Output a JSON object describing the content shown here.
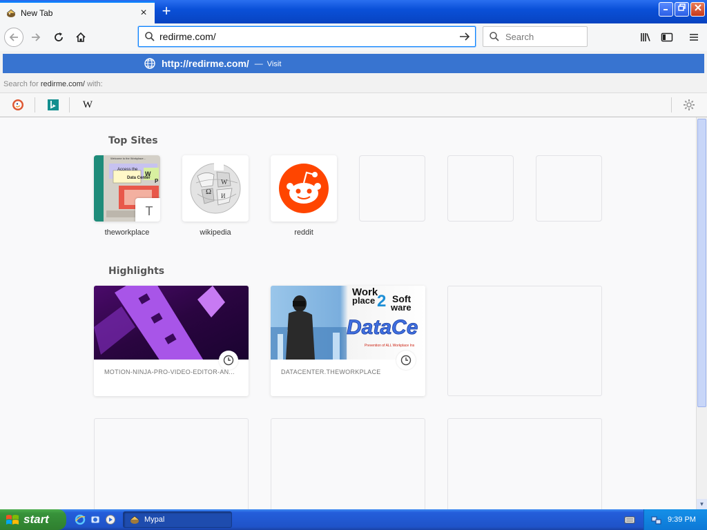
{
  "browser": {
    "tab_title": "New Tab",
    "tab_close": "×",
    "new_tab": "+",
    "url": "redirme.com/",
    "search_placeholder": "Search"
  },
  "popup": {
    "visit_url": "http://redirme.com/",
    "visit_dash": "—",
    "visit_label": "Visit",
    "search_for_prefix": "Search for",
    "search_for_query": "redirme.com/",
    "search_for_suffix": "with:",
    "engines": [
      "duckduckgo-icon",
      "bing-icon",
      "wikipedia-icon"
    ],
    "wiki_glyph": "W"
  },
  "content": {
    "top_sites_title": "Top Sites",
    "highlights_title": "Highlights",
    "top_sites": [
      {
        "label": "theworkplace",
        "badge": "T"
      },
      {
        "label": "wikipedia"
      },
      {
        "label": "reddit"
      }
    ],
    "highlights": [
      {
        "text": "MOTION-NINJA-PRO-VIDEO-EDITOR-AN..."
      },
      {
        "text": "DATACENTER.THEWORKPLACE",
        "brand1": "Work",
        "brand2": "place",
        "brand3": "2",
        "brand4": "Soft",
        "brand5": "ware",
        "brand6": "DataCe",
        "tagline": "Prevention of ALL Workplace Ins"
      }
    ],
    "tile_texts": [
      "Welcome to the Workplace...",
      "Access the",
      "Data Center",
      "W",
      "P"
    ]
  },
  "taskbar": {
    "start_label": "start",
    "window_label": "Mypal",
    "clock": "9:39 PM"
  },
  "colors": {
    "accent": "#0a84ff",
    "visit_row": "#3874d0",
    "reddit": "#ff4500",
    "taskbar": "#245edb",
    "start": "#37923a"
  }
}
